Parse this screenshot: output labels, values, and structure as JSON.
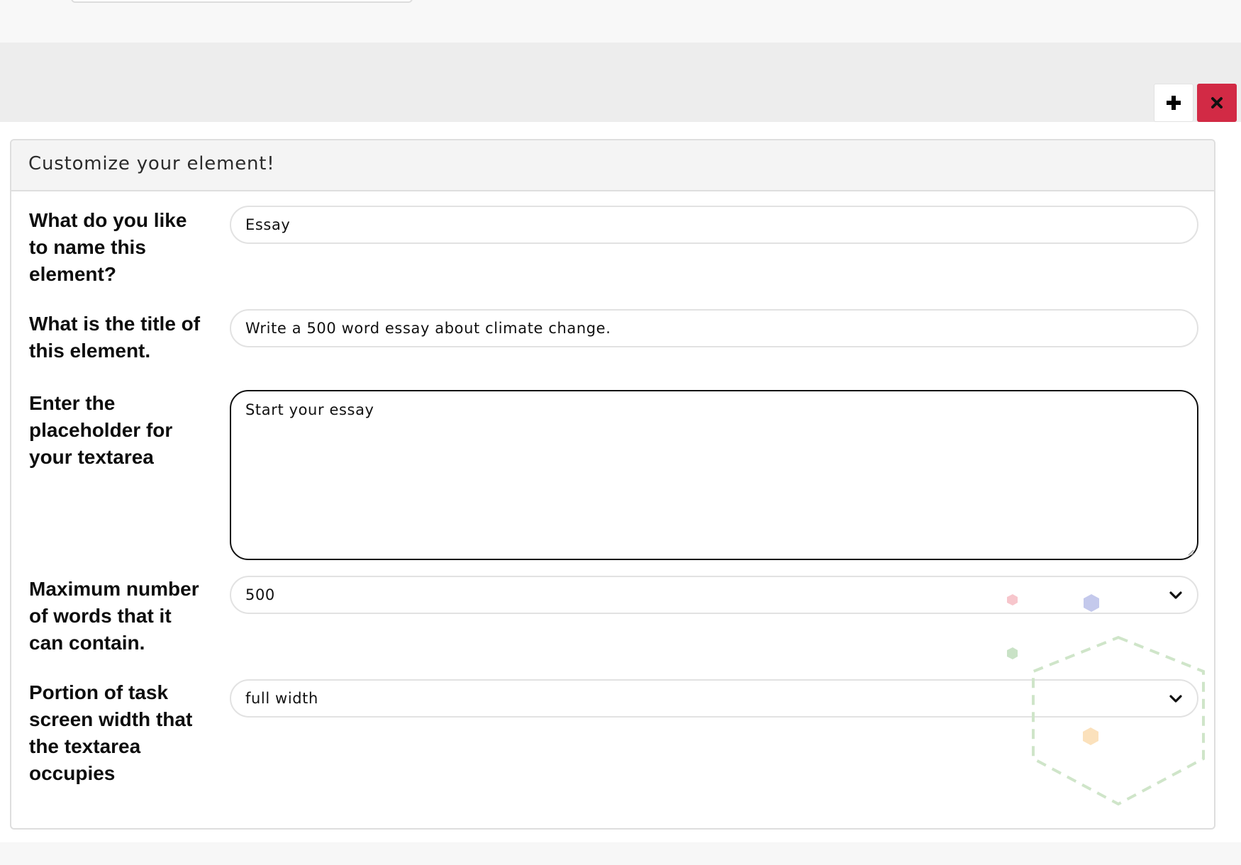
{
  "header": {
    "add_icon": "plus-icon",
    "close_icon": "close-x-icon",
    "close_color": "#d22a45"
  },
  "card": {
    "title": "Customize your element!",
    "fields": {
      "name": {
        "label": "What do you like to name this element?",
        "value": "Essay"
      },
      "title": {
        "label": "What is the title of this element.",
        "value": "Write a 500 word essay about climate change."
      },
      "placeholder": {
        "label": "Enter the placeholder for your textarea",
        "value": "Start your essay"
      },
      "max_words": {
        "label": "Maximum number of words that it can contain.",
        "value": "500"
      },
      "width": {
        "label": "Portion of task screen width that the textarea occupies",
        "value": "full width"
      }
    }
  },
  "decoration": {
    "colors": [
      "#f7c6cc",
      "#c4c9ec",
      "#c9e2c6",
      "#fbe1bc",
      "#cfe5c9"
    ]
  }
}
